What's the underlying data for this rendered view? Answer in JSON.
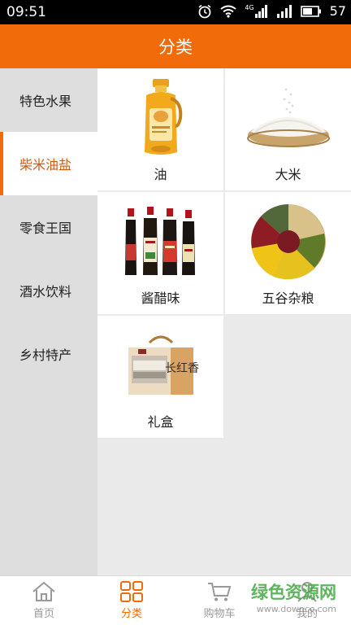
{
  "status_bar": {
    "time": "09:51",
    "signal_label": "4G",
    "battery": "57"
  },
  "header": {
    "title": "分类"
  },
  "sidebar": {
    "items": [
      {
        "label": "特色水果",
        "active": false
      },
      {
        "label": "柴米油盐",
        "active": true
      },
      {
        "label": "零食王国",
        "active": false
      },
      {
        "label": "酒水饮料",
        "active": false
      },
      {
        "label": "乡村特产",
        "active": false
      }
    ]
  },
  "categories": [
    {
      "label": "油",
      "icon": "oil-bottle-image"
    },
    {
      "label": "大米",
      "icon": "rice-bowl-image"
    },
    {
      "label": "酱醋味",
      "icon": "sauce-bottles-image"
    },
    {
      "label": "五谷杂粮",
      "icon": "grains-image"
    },
    {
      "label": "礼盒",
      "icon": "gift-box-image"
    }
  ],
  "gift_box_text": "长红香",
  "tab_bar": {
    "items": [
      {
        "label": "首页",
        "icon": "home-icon",
        "active": false
      },
      {
        "label": "分类",
        "icon": "grid-icon",
        "active": true
      },
      {
        "label": "购物车",
        "icon": "cart-icon",
        "active": false
      },
      {
        "label": "我的",
        "icon": "user-icon",
        "active": false
      }
    ]
  },
  "watermark": {
    "line1": "绿色资源网",
    "line2": "www.downcc.com"
  },
  "colors": {
    "accent": "#f26b0a",
    "active_text": "#d25a12",
    "sidebar_bg": "#dedede",
    "grid_bg": "#eaeaea"
  }
}
